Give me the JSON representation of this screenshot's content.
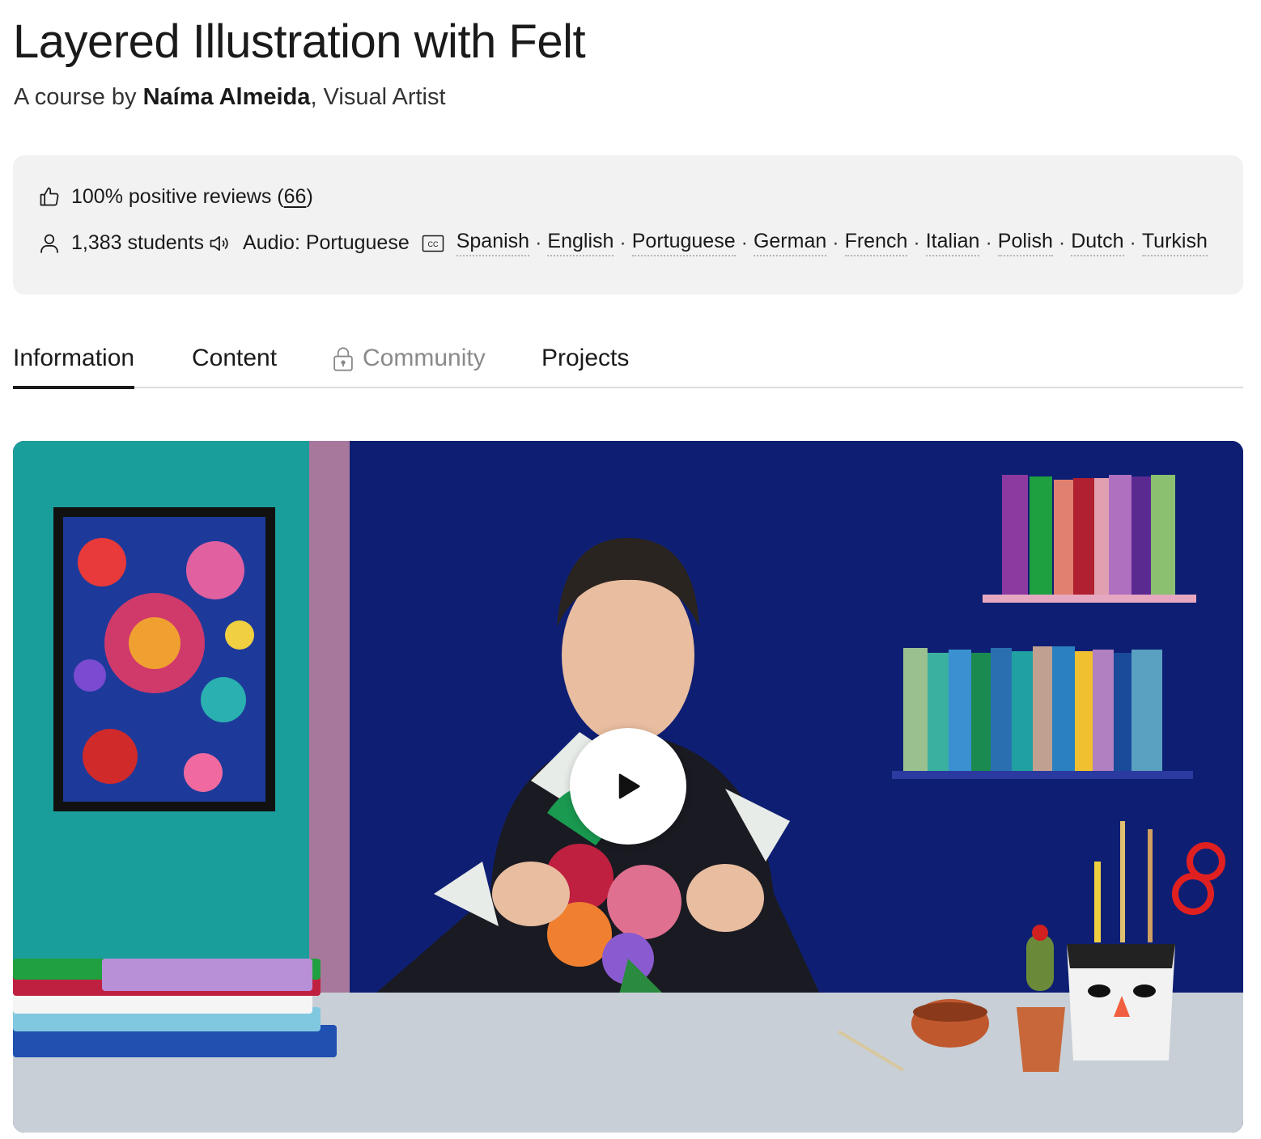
{
  "course": {
    "title": "Layered Illustration with Felt",
    "byline_prefix": "A course by ",
    "author": "Naíma Almeida",
    "byline_suffix": ", Visual Artist"
  },
  "meta": {
    "reviews_text": "100% positive reviews (",
    "reviews_count": "66",
    "reviews_close": ")",
    "students": "1,383 students",
    "audio": "Audio: Portuguese",
    "subtitles": [
      "Spanish",
      "English",
      "Portuguese",
      "German",
      "French",
      "Italian",
      "Polish",
      "Dutch",
      "Turkish"
    ],
    "separator": "·"
  },
  "tabs": [
    {
      "label": "Information",
      "active": true
    },
    {
      "label": "Content",
      "active": false
    },
    {
      "label": "Community",
      "active": false,
      "locked": true
    },
    {
      "label": "Projects",
      "active": false
    }
  ],
  "icons": {
    "reviews": "thumbs-up-icon",
    "students": "user-icon",
    "audio": "speaker-icon",
    "subtitles": "closed-captions-icon",
    "locked": "lock-icon",
    "video": "play-icon"
  },
  "colors": {
    "text": "#1a1a1a",
    "muted": "#8a8a8a",
    "panel": "#f2f2f2",
    "wall": "#0e1f73",
    "teal": "#1a9e9b"
  }
}
